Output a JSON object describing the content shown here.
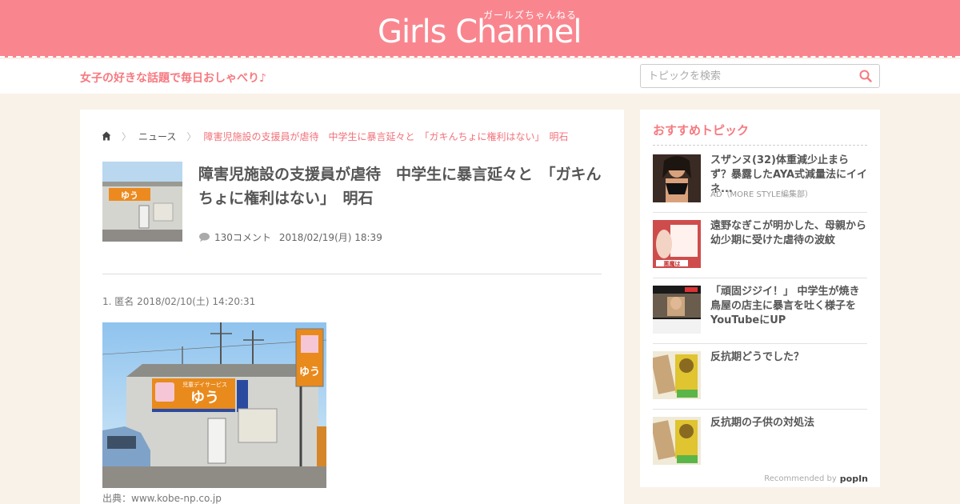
{
  "header": {
    "logo_kana": "ガールズちゃんねる",
    "logo": "Girls Channel",
    "tagline": "女子の好きな話題で毎日おしゃべり♪",
    "search_placeholder": "トピックを検索"
  },
  "breadcrumb": {
    "news": "ニュース",
    "current": "障害児施設の支援員が虐待　中学生に暴言延々と　「ガキんちょに権利はない」　明石"
  },
  "topic": {
    "title": "障害児施設の支援員が虐待　中学生に暴言延々と　「ガキんちょに権利はない」　明石",
    "comments": "130コメント",
    "date": "2018/02/19(月) 18:39",
    "thumb_sign": "ゆう"
  },
  "post": {
    "header": "1. 匿名 2018/02/10(土) 14:20:31",
    "sign_small": "児童デイサービス",
    "sign_name": "ゆう",
    "source": "出典：www.kobe-np.co.jp"
  },
  "sidebar": {
    "title": "おすすめトピック",
    "items": [
      {
        "text": "スザンヌ(32)体重減少止まらず？暴露したAYA式減量法にイイネ...",
        "ad": "AD（MORE STYLE編集部）"
      },
      {
        "text": "遠野なぎこが明かした、母親から幼少期に受けた虐待の波紋"
      },
      {
        "text": "「頑固ジジイ！」 中学生が焼き鳥屋の店主に暴言を吐く様子をYouTubeにUP"
      },
      {
        "text": "反抗期どうでした？"
      },
      {
        "text": "反抗期の子供の対処法"
      }
    ],
    "recommended_by": "Recommended by",
    "popin": "popIn"
  },
  "colors": {
    "brand_pink": "#f9868f",
    "accent_pink": "#f6797f",
    "page_bg": "#f9f2e8"
  }
}
